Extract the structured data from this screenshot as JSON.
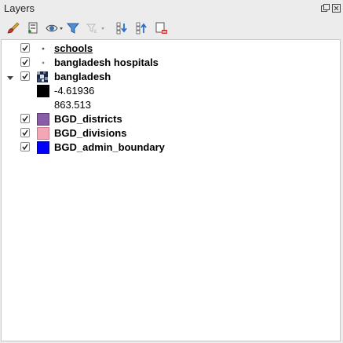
{
  "panel": {
    "title": "Layers"
  },
  "toolbar": {
    "buttons": [
      {
        "name": "style-manager",
        "icon": "paintbrush-icon"
      },
      {
        "name": "add-group",
        "icon": "add-group-icon"
      },
      {
        "name": "manage-visibility",
        "icon": "eye-icon"
      },
      {
        "name": "filter-legend",
        "icon": "funnel-icon"
      },
      {
        "name": "filter-by-expression",
        "icon": "expression-filter-icon"
      },
      {
        "name": "expand-all",
        "icon": "expand-all-icon"
      },
      {
        "name": "collapse-all",
        "icon": "collapse-all-icon"
      },
      {
        "name": "remove-layer",
        "icon": "remove-layer-icon"
      }
    ]
  },
  "layers": [
    {
      "name": "schools",
      "checked": true,
      "symbol": "point",
      "bold": true,
      "underline": true
    },
    {
      "name": "bangladesh hospitals",
      "checked": true,
      "symbol": "point",
      "bold": true
    },
    {
      "name": "bangladesh",
      "checked": true,
      "symbol": "raster",
      "bold": true,
      "expanded": true,
      "legend": [
        {
          "label": "-4.61936",
          "color": "#000000"
        },
        {
          "label": "863.513",
          "color": "#ffffff"
        }
      ]
    },
    {
      "name": "BGD_districts",
      "checked": true,
      "symbol": "fill",
      "color": "#8a5ca8",
      "bold": true
    },
    {
      "name": "BGD_divisions",
      "checked": true,
      "symbol": "fill",
      "color": "#f4a6b6",
      "bold": true
    },
    {
      "name": "BGD_admin_boundary",
      "checked": true,
      "symbol": "fill",
      "color": "#0000ff",
      "bold": true
    }
  ]
}
